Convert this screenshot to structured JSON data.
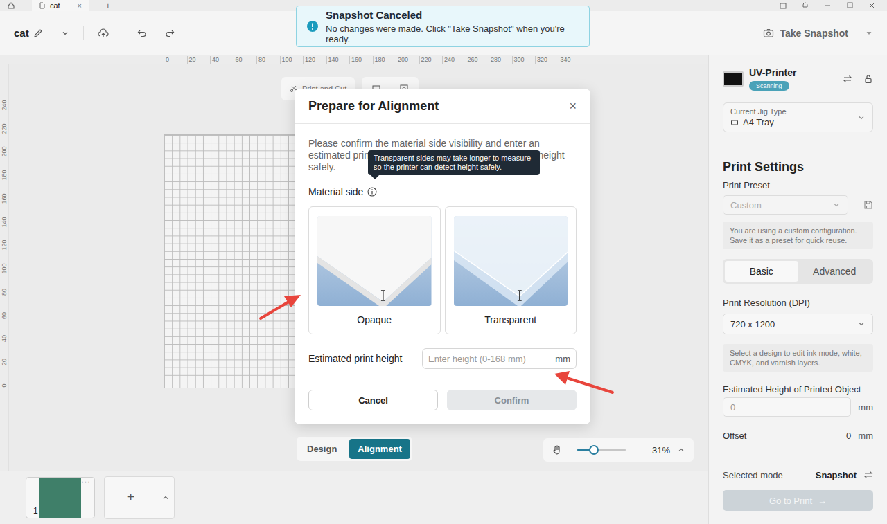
{
  "tab_strip": {
    "tabs": [
      {
        "label": "cat",
        "close": "×",
        "selected": true
      }
    ],
    "new_tab": "+"
  },
  "toolbar": {
    "document": "cat",
    "snapshot_button": "Take Snapshot"
  },
  "toast": {
    "title": "Snapshot Canceled",
    "message": "No changes were made. Click \"Take Snapshot\" when you're ready."
  },
  "canvas": {
    "ruler_top": [
      "0",
      "20",
      "40",
      "60",
      "80",
      "100",
      "120",
      "140",
      "160",
      "180",
      "200",
      "220",
      "240",
      "260",
      "280",
      "300",
      "320",
      "340"
    ],
    "ruler_left": [
      "240",
      "220",
      "200",
      "180",
      "160",
      "140",
      "120",
      "100",
      "80",
      "60",
      "40",
      "20",
      "0"
    ],
    "floating_tool": "Print and Cut"
  },
  "view_tabs": [
    {
      "label": "Design",
      "selected": false
    },
    {
      "label": "Alignment",
      "selected": true
    }
  ],
  "zoom": {
    "level": 0.34,
    "reading": "31%"
  },
  "pages": {
    "items": [
      {
        "number": "1",
        "menu": "···",
        "selected": true
      }
    ],
    "add": "+"
  },
  "dialog": {
    "title": "Prepare for Alignment",
    "close": "×",
    "description": "Please confirm the material side visibility and enter an estimated print height so the printer can measure the height safely.",
    "tooltip": "Transparent sides may take longer to measure so the printer can detect height safely.",
    "material_label": "Material side",
    "options": [
      {
        "label": "Opaque",
        "kind": "opaque",
        "selected": false
      },
      {
        "label": "Transparent",
        "kind": "transparent",
        "selected": false
      }
    ],
    "height_label": "Estimated print height",
    "height_placeholder": "Enter height (0-168 mm)",
    "height_unit": "mm",
    "buttons": [
      {
        "label": "Cancel",
        "disabled": false,
        "primary": false
      },
      {
        "label": "Confirm",
        "disabled": true,
        "primary": true
      }
    ]
  },
  "printer_panel": {
    "printer": {
      "name": "UV-Printer",
      "status": "Scanning"
    },
    "jig": {
      "label": "Current Jig Type",
      "value": "A4 Tray"
    },
    "title": "Print Settings",
    "preset_label": "Print Preset",
    "preset_value": "Custom",
    "preset_disabled": true,
    "preset_note": "You are using a custom configuration. Save it as a preset for quick reuse.",
    "modes": [
      {
        "label": "Basic",
        "selected": true
      },
      {
        "label": "Advanced",
        "selected": false
      }
    ],
    "resolution_label": "Print Resolution (DPI)",
    "resolution_value": "720 x 1200",
    "layers_note": "Select a design to edit ink mode, white, CMYK, and varnish layers.",
    "height_label": "Estimated Height of Printed Object",
    "height_value": "0",
    "height_unit": "mm",
    "offset_label": "Offset",
    "offset_value": "0",
    "offset_unit": "mm",
    "mode_label": "Selected mode",
    "mode_value": "Snapshot",
    "go_button": "Go to Print",
    "go_arrow": "→",
    "go_disabled": true
  }
}
